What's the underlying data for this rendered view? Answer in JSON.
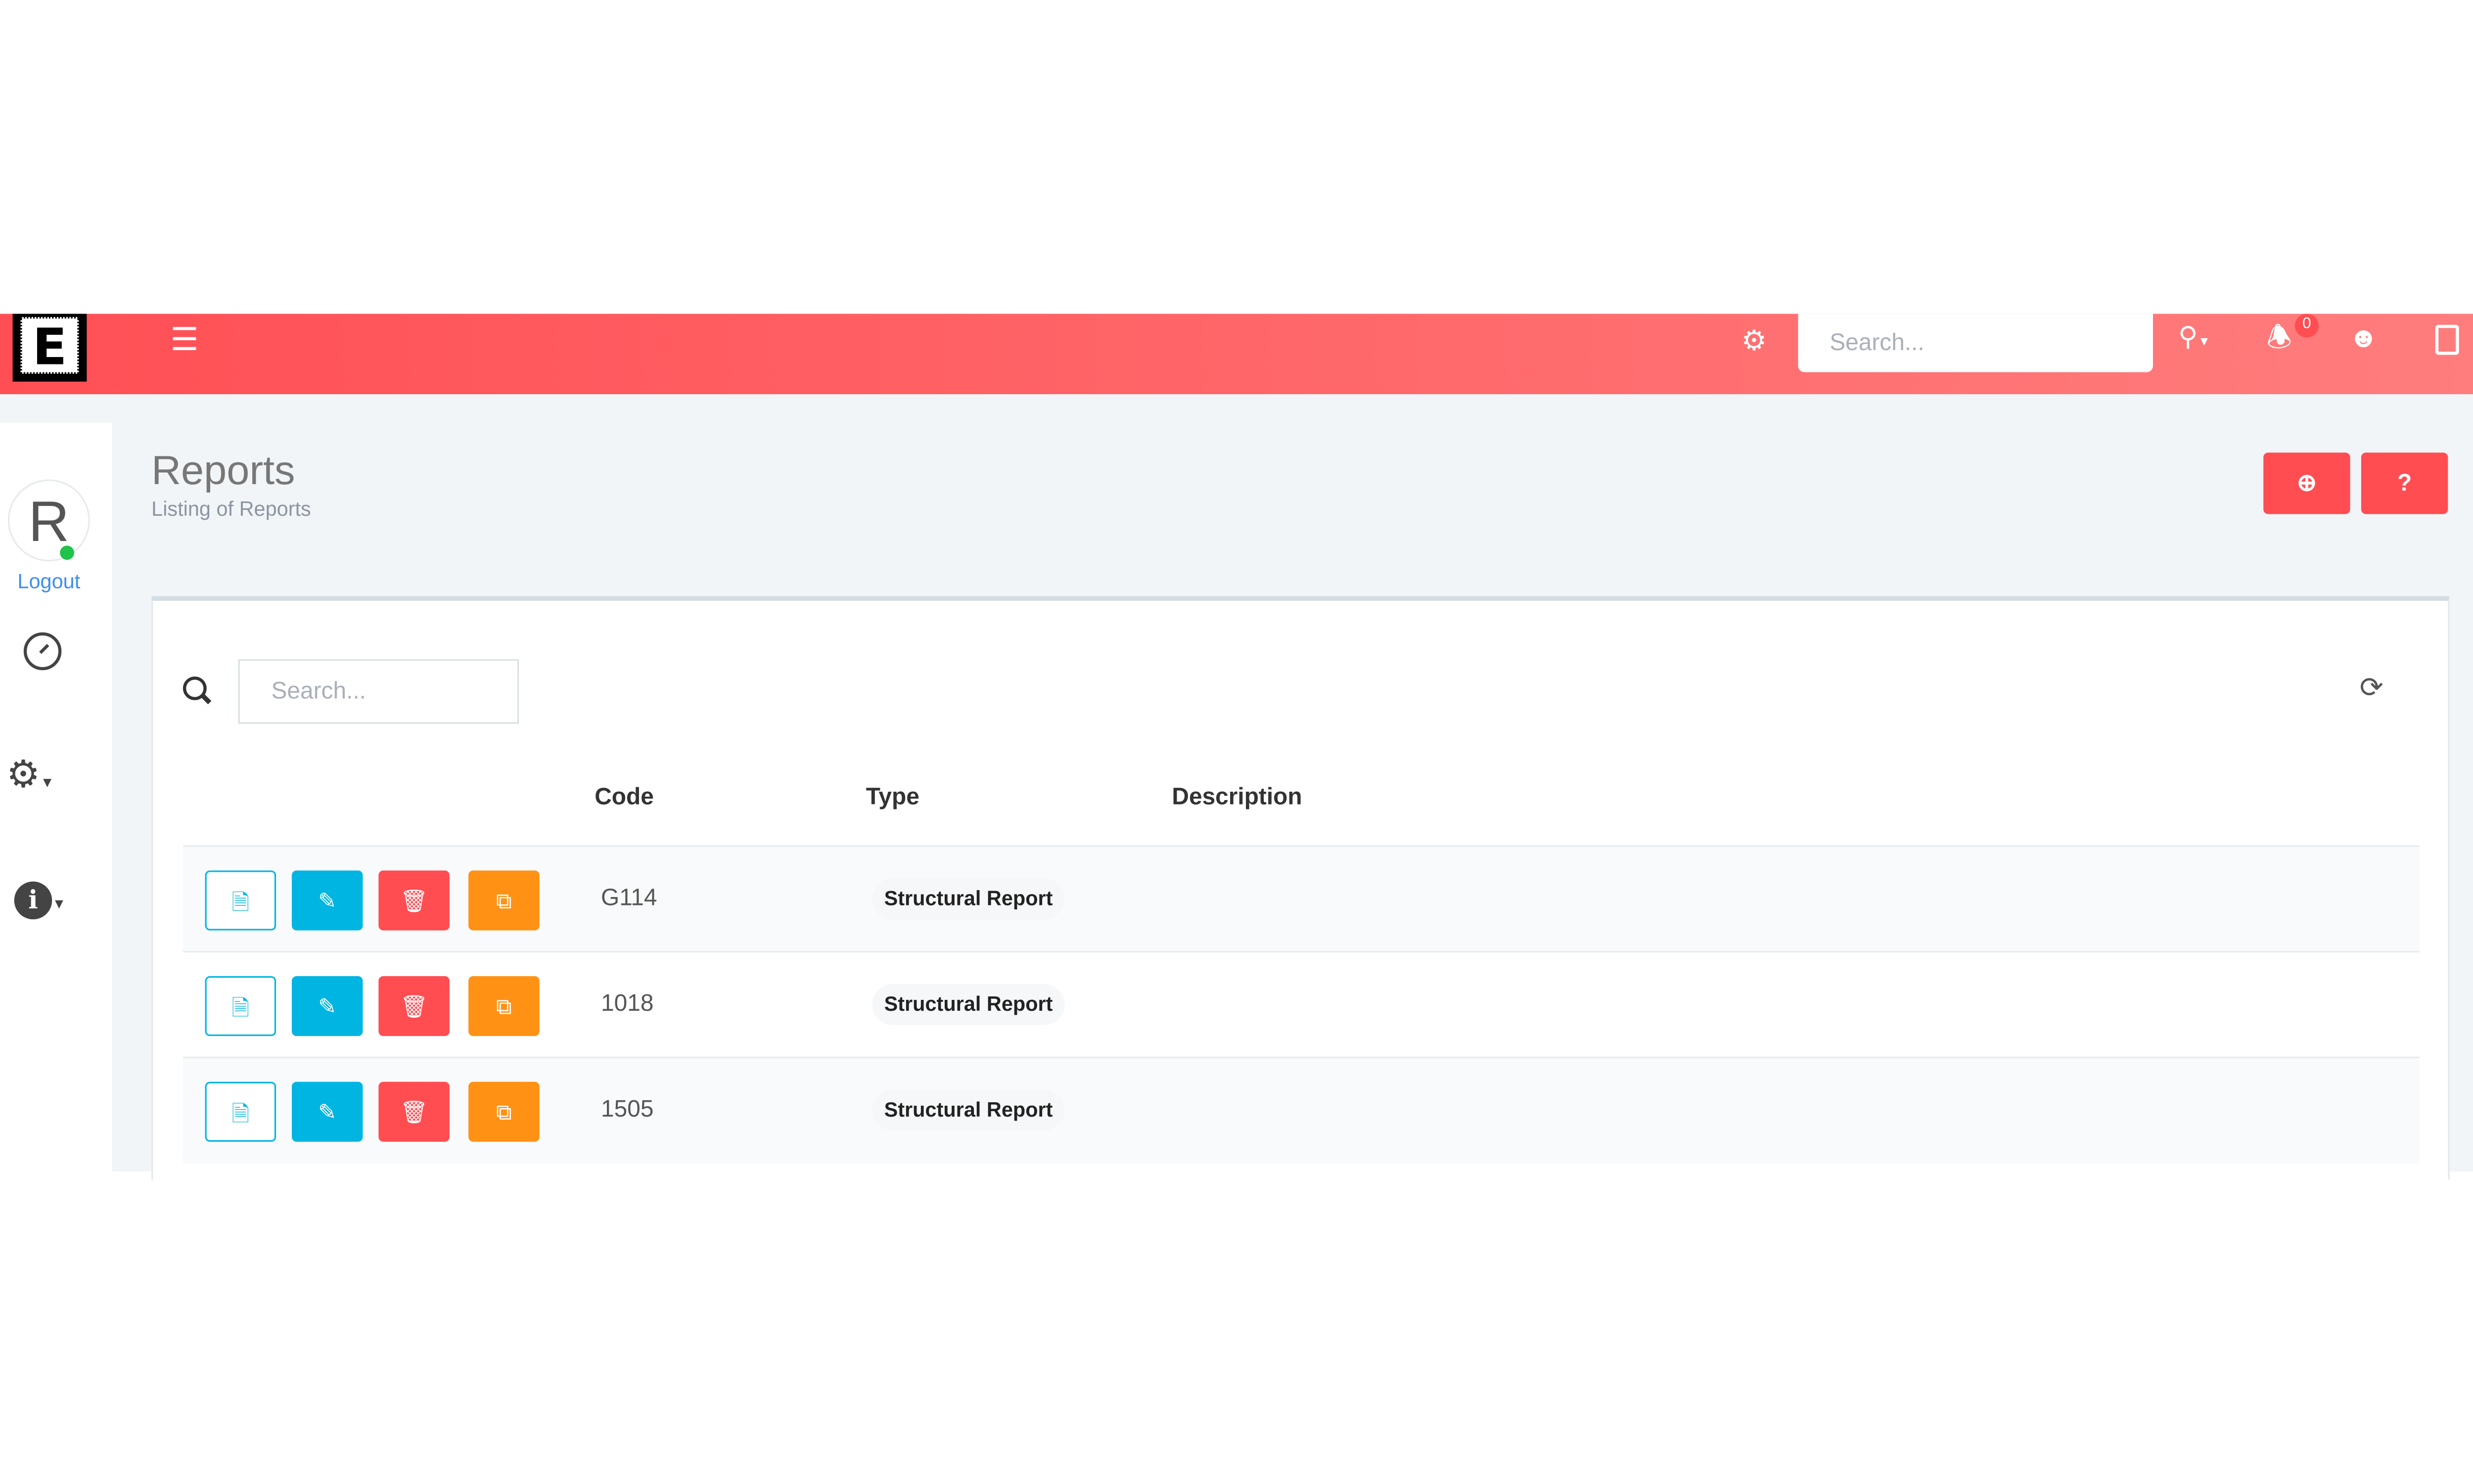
{
  "topbar": {
    "logo_text": "E",
    "search_placeholder": "Search...",
    "notification_count": "0",
    "icons": [
      "menu-icon",
      "gear-icon",
      "search-dropdown-icon",
      "bell-icon",
      "user-icon",
      "panel-icon"
    ]
  },
  "sidebar": {
    "avatar_initial": "R",
    "logout_label": "Logout",
    "items": [
      "dashboard-gauge-icon",
      "settings-gears-icon",
      "info-icon"
    ]
  },
  "page": {
    "title": "Reports",
    "subtitle": "Listing of Reports"
  },
  "listing": {
    "search_placeholder": "Search...",
    "columns": [
      "Code",
      "Type",
      "Description"
    ],
    "rows": [
      {
        "code": "G114",
        "type": "Structural Report",
        "description": ""
      },
      {
        "code": "1018",
        "type": "Structural Report",
        "description": ""
      },
      {
        "code": "1505",
        "type": "Structural Report",
        "description": ""
      }
    ]
  },
  "colors": {
    "brand": "#ff4f55",
    "info": "#00b5e2",
    "danger": "#ff4d52",
    "warning": "#ff9214",
    "online": "#1fc24a"
  }
}
